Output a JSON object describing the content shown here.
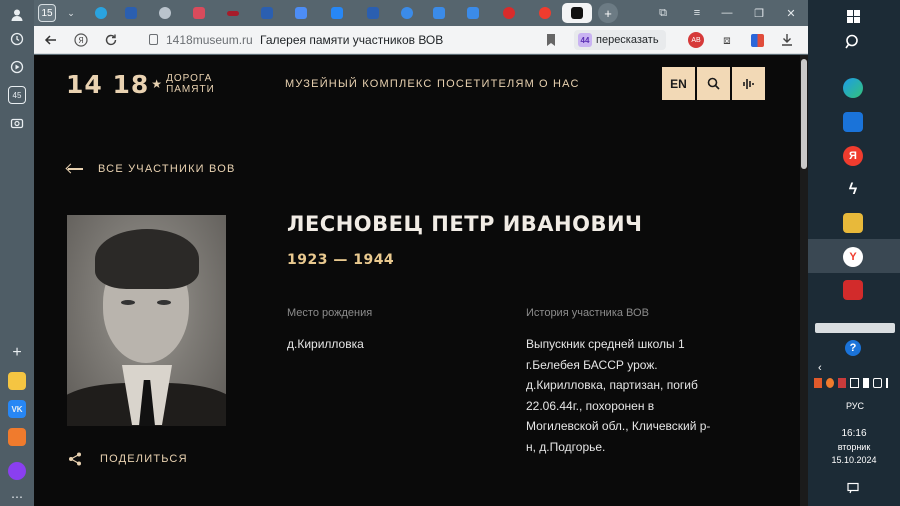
{
  "sidebar": {
    "badge": "45"
  },
  "tabstrip": {
    "tab_count": "15"
  },
  "addressbar": {
    "url": "1418museum.ru",
    "page_title": "Галерея памяти участников ВОВ",
    "retell_label": "пересказать"
  },
  "site": {
    "logo_numbers": "14 18",
    "logo_line1": "ДОРОГА",
    "logo_line2": "ПАМЯТИ",
    "nav": [
      "МУЗЕЙНЫЙ КОМПЛЕКС",
      "ПОСЕТИТЕЛЯМ",
      "О НАС"
    ],
    "lang_button": "EN",
    "back_link": "ВСЕ УЧАСТНИКИ ВОВ",
    "share_label": "ПОДЕЛИТЬСЯ"
  },
  "person": {
    "name": "ЛЕСНОВЕЦ ПЕТР ИВАНОВИЧ",
    "years": "1923 — 1944",
    "birthplace_label": "Место рождения",
    "birthplace": "д.Кирилловка",
    "history_label": "История участника ВОВ",
    "history_lines": [
      "Выпускник средней школы 1",
      "г.Белебея БАССР урож.",
      "д.Кирилловка, партизан, погиб",
      "22.06.44г., похоронен в",
      "Могилевской обл., Кличевский р-",
      "н, д.Подгорье."
    ]
  },
  "taskbar": {
    "lang": "РУС",
    "time": "16:16",
    "weekday": "вторник",
    "date": "15.10.2024"
  },
  "colors": {
    "accent": "#e9d2b1",
    "button_bg": "#f2d9b6",
    "years": "#e9c98f",
    "page_bg": "#0a0a0a"
  }
}
